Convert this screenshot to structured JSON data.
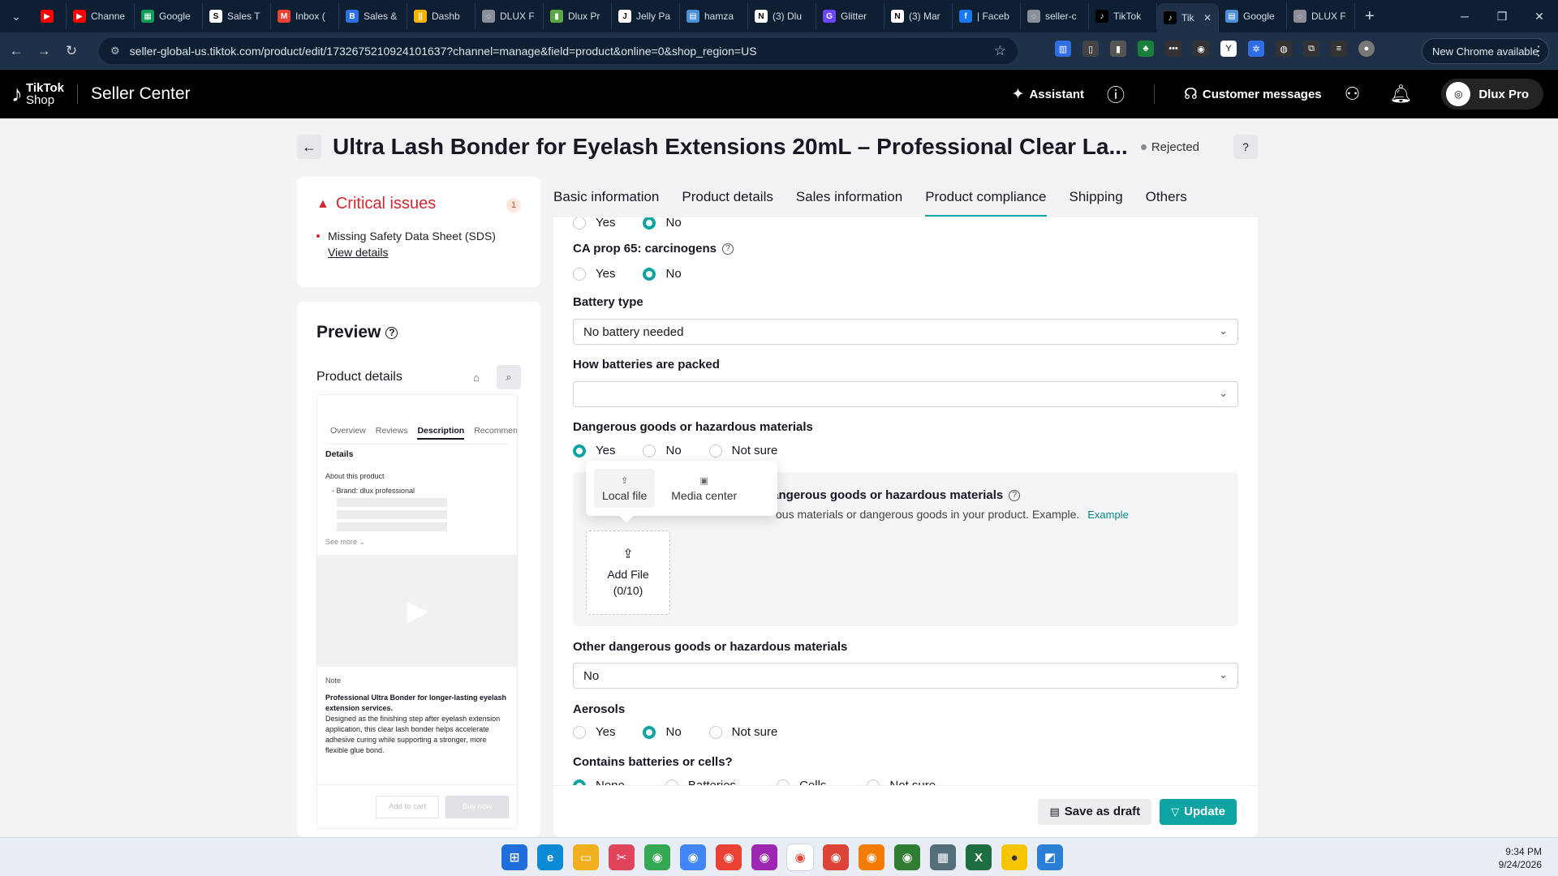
{
  "browser": {
    "tabs": [
      {
        "label": "",
        "color": "#ff0000",
        "glyph": "▶"
      },
      {
        "label": "Channe",
        "color": "#ff0000",
        "glyph": "▶"
      },
      {
        "label": "Google",
        "color": "#0f9d58",
        "glyph": "▦"
      },
      {
        "label": "Sales T",
        "color": "#ffffff",
        "glyph": "S"
      },
      {
        "label": "Inbox (",
        "color": "#ea4335",
        "glyph": "M"
      },
      {
        "label": "Sales &",
        "color": "#2f6fe4",
        "glyph": "B"
      },
      {
        "label": "Dashb",
        "color": "#f4b400",
        "glyph": "||"
      },
      {
        "label": "DLUX F",
        "color": "#8a8f98",
        "glyph": "◌"
      },
      {
        "label": "Dlux Pr",
        "color": "#5ba745",
        "glyph": "▮"
      },
      {
        "label": "Jelly Pa",
        "color": "#ffffff",
        "glyph": "J"
      },
      {
        "label": "hamza",
        "color": "#4a90d9",
        "glyph": "▤"
      },
      {
        "label": "(3) Dlu",
        "color": "#ffffff",
        "glyph": "N"
      },
      {
        "label": "Glitter",
        "color": "#6c47ff",
        "glyph": "G"
      },
      {
        "label": "(3) Mar",
        "color": "#ffffff",
        "glyph": "N"
      },
      {
        "label": "| Faceb",
        "color": "#1877f2",
        "glyph": "f"
      },
      {
        "label": "seller-c",
        "color": "#8a8f98",
        "glyph": "◌"
      },
      {
        "label": "TikTok",
        "color": "#000000",
        "glyph": "♪"
      },
      {
        "label": "Tik",
        "color": "#000000",
        "glyph": "♪",
        "active": true
      },
      {
        "label": "Google",
        "color": "#4a90d9",
        "glyph": "▤"
      },
      {
        "label": "DLUX F",
        "color": "#8a8f98",
        "glyph": "◌"
      }
    ],
    "url": "seller-global-us.tiktok.com/product/edit/1732675210924101637?channel=manage&field=product&online=0&shop_region=US",
    "new_chrome_label": "New Chrome available"
  },
  "header": {
    "logo_line1": "TikTok",
    "logo_line2": "Shop",
    "app_title": "Seller Center",
    "assistant_label": "Assistant",
    "customer_messages_label": "Customer messages",
    "profile_name": "Dlux Pro"
  },
  "page": {
    "title": "Ultra Lash Bonder for Eyelash Extensions 20mL – Professional Clear La...",
    "status": "Rejected"
  },
  "critical": {
    "title": "Critical issues",
    "count": "1",
    "item_text": "Missing Safety Data Sheet (SDS)",
    "item_link": "View details"
  },
  "preview": {
    "title": "Preview",
    "product_details_label": "Product details",
    "phone_tabs": [
      "Overview",
      "Reviews",
      "Description",
      "Recommen"
    ],
    "details_heading": "Details",
    "about_label": "About this product",
    "brand_line": "Brand: dlux professional",
    "see_more": "See more",
    "note_label": "Note",
    "note_title": "Professional Ultra Bonder for longer-lasting eyelash extension services.",
    "note_body": "Designed as the finishing step after eyelash extension application, this clear lash bonder helps accelerate adhesive curing while supporting a stronger, more flexible glue bond.",
    "add_to_cart": "Add to cart",
    "buy_now": "Buy now"
  },
  "tabs": [
    "Basic information",
    "Product details",
    "Sales information",
    "Product compliance",
    "Shipping",
    "Others"
  ],
  "form": {
    "yes": "Yes",
    "no": "No",
    "not_sure": "Not sure",
    "ca_prop_label": "CA prop 65: carcinogens",
    "battery_type_label": "Battery type",
    "battery_type_value": "No battery needed",
    "batteries_packed_label": "How batteries are packed",
    "batteries_packed_value": "",
    "dangerous_label": "Dangerous goods or hazardous materials",
    "upload_title": "dangerous goods or hazardous materials",
    "upload_desc": "ous materials or dangerous goods in your product. Example.",
    "upload_link": "Example",
    "add_file_label": "Add File",
    "add_file_count": "(0/10)",
    "local_file": "Local file",
    "media_center": "Media center",
    "other_dangerous_label": "Other dangerous goods or hazardous materials",
    "other_dangerous_value": "No",
    "aerosols_label": "Aerosols",
    "contains_batteries_label": "Contains batteries or cells?",
    "cb_options": [
      "None",
      "Batteries",
      "Cells",
      "Not sure"
    ]
  },
  "footer": {
    "save_draft": "Save as draft",
    "update": "Update"
  },
  "taskbar": {
    "time": "9:34 PM",
    "date": "9/24/2026"
  },
  "colors": {
    "accent": "#0fa4a4",
    "critical": "#d4262f"
  }
}
